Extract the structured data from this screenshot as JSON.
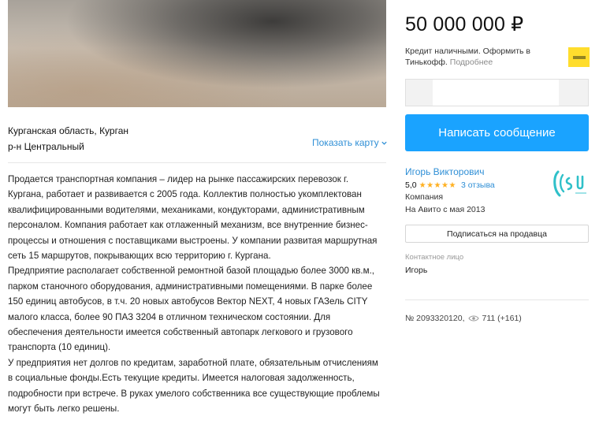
{
  "listing": {
    "location_region": "Курганская область, Курган",
    "location_district": "р-н Центральный",
    "show_map_label": "Показать карту",
    "description": [
      "Продается транспортная компания – лидер на рынке пассажирских перевозок г. Кургана, работает и развивается с 2005 года. Коллектив полностью укомплектован квалифицированными водителями, механиками, кондукторами, административным персоналом. Компания работает как отлаженный механизм, все внутренние бизнес-процессы и отношения с поставщиками выстроены. У компании развитая маршрутная сеть 15 маршрутов, покрывающих всю территорию г. Кургана.",
      "Предприятие располагает собственной ремонтной базой площадью более 3000 кв.м., парком станочного оборудования, административными помещениями. В парке более 150 единиц автобусов, в т.ч. 20 новых автобусов Вектор NEXT, 4 новых ГАЗель CITY малого класса, более 90 ПАЗ 3204 в отличном техническом состоянии. Для обеспечения деятельности имеется собственный автопарк легкового и грузового транспорта (10 единиц).",
      "У предприятия нет долгов по кредитам, заработной плате, обязательным отчислениям в социальные фонды.Есть текущие кредиты. Имеется налоговая задолженность, подробности при встрече. В руках умелого собственника все существующие проблемы могут быть легко решены."
    ]
  },
  "sidebar": {
    "price": "50 000 000 ₽",
    "credit_text": "Кредит наличными. Оформить в Тинькофф.",
    "credit_more": "Подробнее",
    "message_button": "Написать сообщение",
    "seller": {
      "name": "Игорь Викторович",
      "rating": "5,0",
      "stars": "★★★★★",
      "reviews": "3 отзыва",
      "type": "Компания",
      "since": "На Авито с мая 2013"
    },
    "subscribe_button": "Подписаться на продавца",
    "contact_label": "Контактное лицо",
    "contact_name": "Игорь",
    "listing_number": "№ 2093320120,",
    "views": "711 (+161)"
  },
  "colors": {
    "accent": "#1aa3ff",
    "link": "#2f8fd6",
    "star": "#ffb021",
    "tinkoff": "#ffdd2d"
  }
}
